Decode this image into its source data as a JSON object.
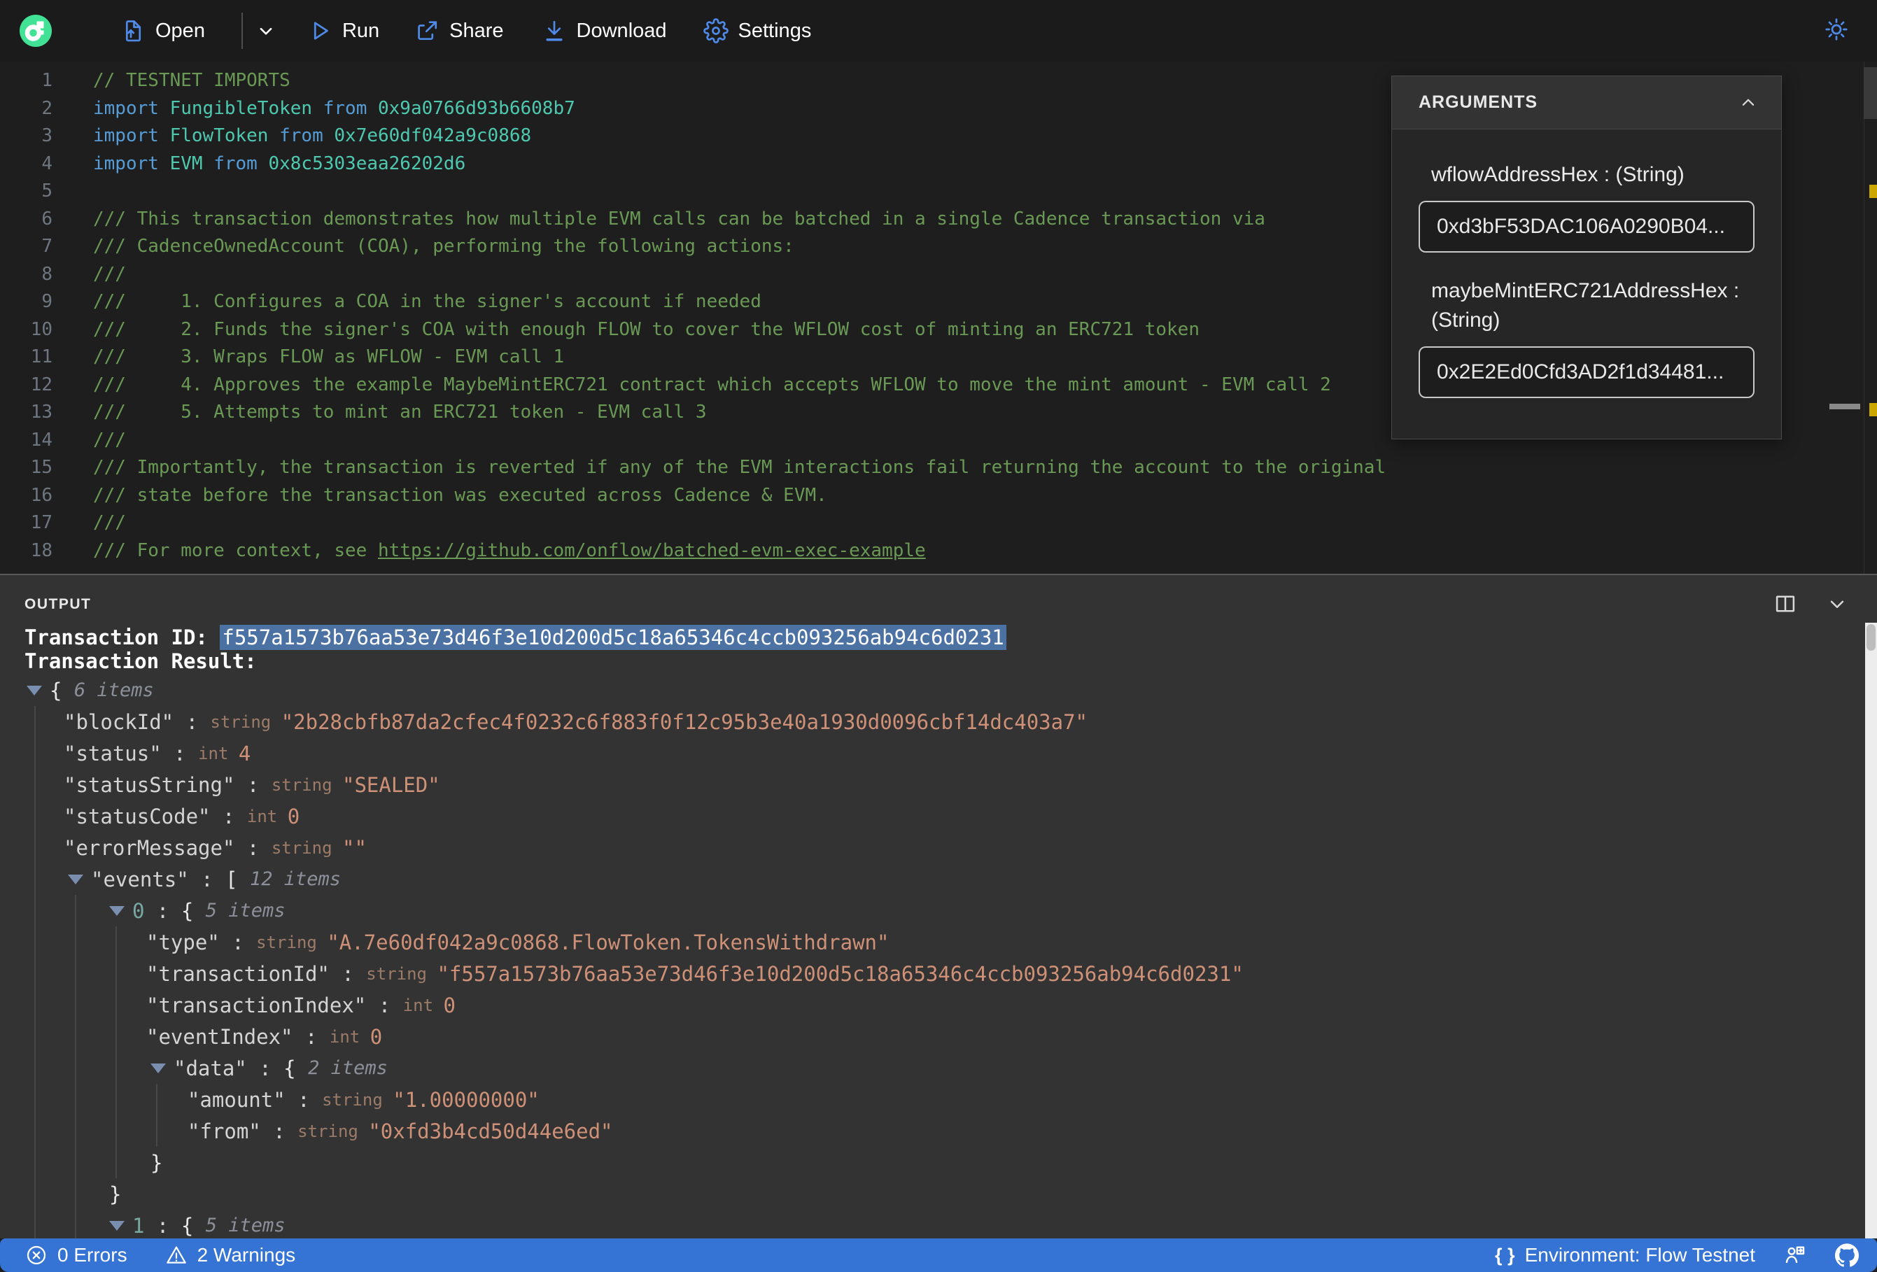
{
  "toolbar": {
    "open_label": "Open",
    "run_label": "Run",
    "share_label": "Share",
    "download_label": "Download",
    "settings_label": "Settings"
  },
  "colors": {
    "accent_blue": "#4f8ae8",
    "flow_green": "#41e296",
    "status_bar_blue": "#3574d4",
    "selection_blue": "#4c72a4",
    "warning_yellow": "#cca700",
    "string_value": "#ce9178",
    "comment_green": "#6a9955"
  },
  "editor": {
    "lines": [
      {
        "n": "1",
        "tokens": [
          {
            "t": "// TESTNET IMPORTS",
            "c": "comment"
          }
        ]
      },
      {
        "n": "2",
        "tokens": [
          {
            "t": "import ",
            "c": "kw"
          },
          {
            "t": "FungibleToken",
            "c": "type"
          },
          {
            "t": " from ",
            "c": "kw"
          },
          {
            "t": "0x9a0766d93b6608b7",
            "c": "addr"
          }
        ]
      },
      {
        "n": "3",
        "tokens": [
          {
            "t": "import ",
            "c": "kw"
          },
          {
            "t": "FlowToken",
            "c": "type"
          },
          {
            "t": " from ",
            "c": "kw"
          },
          {
            "t": "0x7e60df042a9c0868",
            "c": "addr"
          }
        ]
      },
      {
        "n": "4",
        "tokens": [
          {
            "t": "import ",
            "c": "kw"
          },
          {
            "t": "EVM",
            "c": "type"
          },
          {
            "t": " from ",
            "c": "kw"
          },
          {
            "t": "0x8c5303eaa26202d6",
            "c": "addr"
          }
        ]
      },
      {
        "n": "5",
        "tokens": []
      },
      {
        "n": "6",
        "tokens": [
          {
            "t": "/// This transaction demonstrates how multiple EVM calls can be batched in a single Cadence transaction via",
            "c": "comment"
          }
        ]
      },
      {
        "n": "7",
        "tokens": [
          {
            "t": "/// CadenceOwnedAccount (COA), performing the following actions:",
            "c": "comment"
          }
        ]
      },
      {
        "n": "8",
        "tokens": [
          {
            "t": "///",
            "c": "comment"
          }
        ]
      },
      {
        "n": "9",
        "tokens": [
          {
            "t": "///     1. Configures a COA in the signer's account if needed",
            "c": "comment"
          }
        ]
      },
      {
        "n": "10",
        "tokens": [
          {
            "t": "///     2. Funds the signer's COA with enough FLOW to cover the WFLOW cost of minting an ERC721 token",
            "c": "comment"
          }
        ]
      },
      {
        "n": "11",
        "tokens": [
          {
            "t": "///     3. Wraps FLOW as WFLOW - EVM call 1",
            "c": "comment"
          }
        ]
      },
      {
        "n": "12",
        "tokens": [
          {
            "t": "///     4. Approves the example MaybeMintERC721 contract which accepts WFLOW to move the mint amount - EVM call 2",
            "c": "comment"
          }
        ]
      },
      {
        "n": "13",
        "tokens": [
          {
            "t": "///     5. Attempts to mint an ERC721 token - EVM call 3",
            "c": "comment"
          }
        ]
      },
      {
        "n": "14",
        "tokens": [
          {
            "t": "///",
            "c": "comment"
          }
        ]
      },
      {
        "n": "15",
        "tokens": [
          {
            "t": "/// Importantly, the transaction is reverted if any of the EVM interactions fail returning the account to the original",
            "c": "comment"
          }
        ]
      },
      {
        "n": "16",
        "tokens": [
          {
            "t": "/// state before the transaction was executed across Cadence & EVM.",
            "c": "comment"
          }
        ]
      },
      {
        "n": "17",
        "tokens": [
          {
            "t": "///",
            "c": "comment"
          }
        ]
      },
      {
        "n": "18",
        "tokens": [
          {
            "t": "/// For more context, see ",
            "c": "comment"
          },
          {
            "t": "https://github.com/onflow/batched-evm-exec-example",
            "c": "link"
          }
        ]
      }
    ]
  },
  "arguments": {
    "title": "ARGUMENTS",
    "fields": [
      {
        "label": "wflowAddressHex : (String)",
        "value": "0xd3bF53DAC106A0290B04..."
      },
      {
        "label": "maybeMintERC721AddressHex : (String)",
        "value": "0x2E2Ed0Cfd3AD2f1d34481..."
      }
    ]
  },
  "output": {
    "title": "OUTPUT",
    "tx_id_label": "Transaction ID: ",
    "tx_id": "f557a1573b76aa53e73d46f3e10d200d5c18a65346c4ccb093256ab94c6d0231",
    "tx_result_label": "Transaction Result:",
    "tree": [
      {
        "depth": 0,
        "kind": "open",
        "segs": [
          {
            "c": "brace",
            "t": "{ "
          },
          {
            "c": "items",
            "t": "6 items"
          }
        ]
      },
      {
        "depth": 0,
        "kind": "field",
        "segs": [
          {
            "c": "key",
            "t": "\"blockId\""
          },
          {
            "c": "colon",
            "t": " : "
          },
          {
            "c": "typ",
            "t": "string "
          },
          {
            "c": "str",
            "t": "\"2b28cbfb87da2cfec4f0232c6f883f0f12c95b3e40a1930d0096cbf14dc403a7\""
          }
        ]
      },
      {
        "depth": 0,
        "kind": "field",
        "segs": [
          {
            "c": "key",
            "t": "\"status\""
          },
          {
            "c": "colon",
            "t": " : "
          },
          {
            "c": "typ",
            "t": "int "
          },
          {
            "c": "num",
            "t": "4"
          }
        ]
      },
      {
        "depth": 0,
        "kind": "field",
        "segs": [
          {
            "c": "key",
            "t": "\"statusString\""
          },
          {
            "c": "colon",
            "t": " : "
          },
          {
            "c": "typ",
            "t": "string "
          },
          {
            "c": "str",
            "t": "\"SEALED\""
          }
        ]
      },
      {
        "depth": 0,
        "kind": "field",
        "segs": [
          {
            "c": "key",
            "t": "\"statusCode\""
          },
          {
            "c": "colon",
            "t": " : "
          },
          {
            "c": "typ",
            "t": "int "
          },
          {
            "c": "num",
            "t": "0"
          }
        ]
      },
      {
        "depth": 0,
        "kind": "field",
        "segs": [
          {
            "c": "key",
            "t": "\"errorMessage\""
          },
          {
            "c": "colon",
            "t": " : "
          },
          {
            "c": "typ",
            "t": "string "
          },
          {
            "c": "str",
            "t": "\"\""
          }
        ]
      },
      {
        "depth": 1,
        "kind": "open",
        "segs": [
          {
            "c": "key",
            "t": "\"events\""
          },
          {
            "c": "colon",
            "t": " : "
          },
          {
            "c": "brace",
            "t": "[ "
          },
          {
            "c": "items",
            "t": "12 items"
          }
        ]
      },
      {
        "depth": 2,
        "kind": "open",
        "segs": [
          {
            "c": "idx",
            "t": "0"
          },
          {
            "c": "colon",
            "t": " : "
          },
          {
            "c": "brace",
            "t": "{ "
          },
          {
            "c": "items",
            "t": "5 items"
          }
        ]
      },
      {
        "depth": 2,
        "kind": "field",
        "segs": [
          {
            "c": "key",
            "t": "\"type\""
          },
          {
            "c": "colon",
            "t": " : "
          },
          {
            "c": "typ",
            "t": "string "
          },
          {
            "c": "str",
            "t": "\"A.7e60df042a9c0868.FlowToken.TokensWithdrawn\""
          }
        ]
      },
      {
        "depth": 2,
        "kind": "field",
        "segs": [
          {
            "c": "key",
            "t": "\"transactionId\""
          },
          {
            "c": "colon",
            "t": " : "
          },
          {
            "c": "typ",
            "t": "string "
          },
          {
            "c": "str",
            "t": "\"f557a1573b76aa53e73d46f3e10d200d5c18a65346c4ccb093256ab94c6d0231\""
          }
        ]
      },
      {
        "depth": 2,
        "kind": "field",
        "segs": [
          {
            "c": "key",
            "t": "\"transactionIndex\""
          },
          {
            "c": "colon",
            "t": " : "
          },
          {
            "c": "typ",
            "t": "int "
          },
          {
            "c": "num",
            "t": "0"
          }
        ]
      },
      {
        "depth": 2,
        "kind": "field",
        "segs": [
          {
            "c": "key",
            "t": "\"eventIndex\""
          },
          {
            "c": "colon",
            "t": " : "
          },
          {
            "c": "typ",
            "t": "int "
          },
          {
            "c": "num",
            "t": "0"
          }
        ]
      },
      {
        "depth": 3,
        "kind": "open",
        "segs": [
          {
            "c": "key",
            "t": "\"data\""
          },
          {
            "c": "colon",
            "t": " : "
          },
          {
            "c": "brace",
            "t": "{ "
          },
          {
            "c": "items",
            "t": "2 items"
          }
        ]
      },
      {
        "depth": 3,
        "kind": "field",
        "segs": [
          {
            "c": "key",
            "t": "\"amount\""
          },
          {
            "c": "colon",
            "t": " : "
          },
          {
            "c": "typ",
            "t": "string "
          },
          {
            "c": "str",
            "t": "\"1.00000000\""
          }
        ]
      },
      {
        "depth": 3,
        "kind": "field",
        "segs": [
          {
            "c": "key",
            "t": "\"from\""
          },
          {
            "c": "colon",
            "t": " : "
          },
          {
            "c": "typ",
            "t": "string "
          },
          {
            "c": "str",
            "t": "\"0xfd3b4cd50d44e6ed\""
          }
        ]
      },
      {
        "depth": 3,
        "kind": "close",
        "segs": [
          {
            "c": "brace",
            "t": "}"
          }
        ]
      },
      {
        "depth": 2,
        "kind": "close",
        "segs": [
          {
            "c": "brace",
            "t": "}"
          }
        ]
      },
      {
        "depth": 2,
        "kind": "open",
        "segs": [
          {
            "c": "idx",
            "t": "1"
          },
          {
            "c": "colon",
            "t": " : "
          },
          {
            "c": "brace",
            "t": "{ "
          },
          {
            "c": "items",
            "t": "5 items"
          }
        ]
      }
    ]
  },
  "statusbar": {
    "errors": "0 Errors",
    "warnings": "2 Warnings",
    "braces_glyph": "{ }",
    "environment": "Environment: Flow Testnet"
  }
}
